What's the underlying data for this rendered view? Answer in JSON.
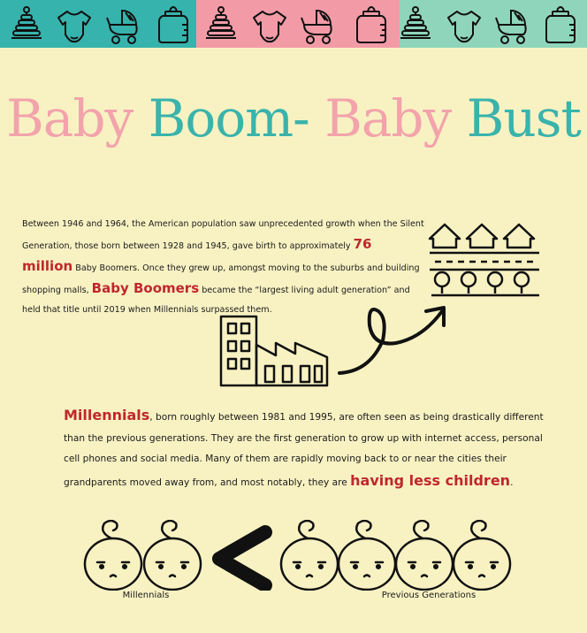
{
  "band_icons": [
    "stacking-rings-toy-icon",
    "baby-onesie-icon",
    "baby-stroller-icon",
    "baby-bottle-icon"
  ],
  "colors": {
    "teal": "#37b3ad",
    "pink": "#f29ba7",
    "mint": "#8fd5bc",
    "highlight": "#c0272d",
    "background": "#f8f2c3"
  },
  "title": {
    "part1": "Baby",
    "part2": "Boom-",
    "part3": "Baby",
    "part4": "Bust"
  },
  "para1": {
    "text_a": "Between 1946 and 1964, the American population saw unprecedented growth when the Silent Generation, those born between 1928 and 1945, gave birth to approximately ",
    "highlight_a": "76 million",
    "text_b": " Baby Boomers. Once they grew up, amongst moving to the suburbs and building shopping malls, ",
    "highlight_b": "Baby Boomers",
    "text_c": " became the “largest living adult generation” and held that title until 2019 when Millennials surpassed them."
  },
  "para2": {
    "highlight_a": "Millennials",
    "text_a": ", born roughly between 1981 and 1995, are often seen as being drastically different than the  previous generations. They are the first generation to grow up with internet access, personal cell phones and social media. Many of them are rapidly moving back to or near the cities their grandparents moved away from, and most notably, they are ",
    "highlight_b": "having less children",
    "text_b": "."
  },
  "comparison": {
    "left_label": "Millennials",
    "right_label": "Previous Generations",
    "symbol": "less-than",
    "left_babies": 2,
    "right_babies": 4
  }
}
